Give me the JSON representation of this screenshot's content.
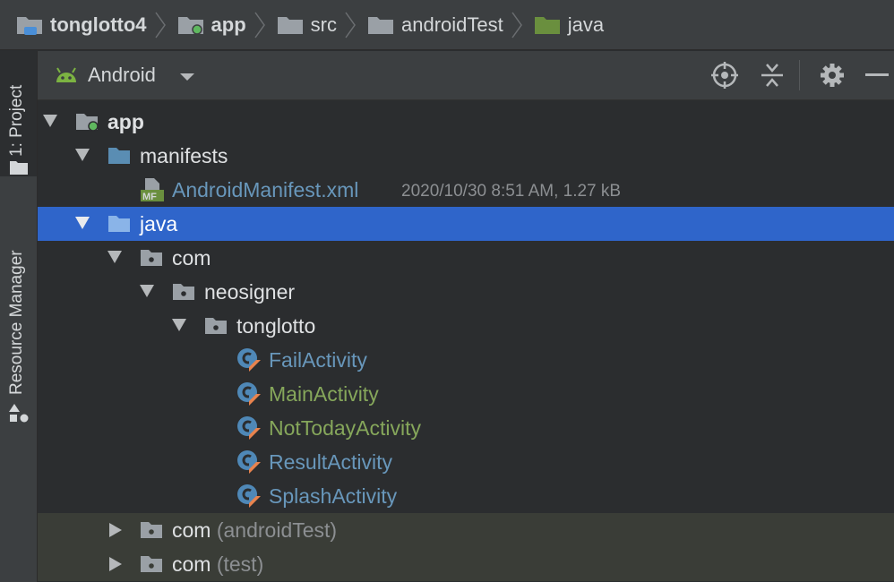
{
  "breadcrumb": [
    {
      "label": "tonglotto4",
      "icon": "project-folder-icon",
      "bold": true
    },
    {
      "label": "app",
      "icon": "module-folder-icon",
      "bold": true
    },
    {
      "label": "src",
      "icon": "folder-icon",
      "bold": false
    },
    {
      "label": "androidTest",
      "icon": "folder-icon",
      "bold": false
    },
    {
      "label": "java",
      "icon": "source-folder-icon",
      "bold": false
    }
  ],
  "stripe": {
    "project_tab": "1: Project",
    "resource_tab": "Resource Manager"
  },
  "toolbar": {
    "view": "Android",
    "icons": [
      "android-icon",
      "dropdown-arrow-icon",
      "locate-icon",
      "collapse-all-icon",
      "settings-gear-icon",
      "hide-minus-icon"
    ]
  },
  "tree": {
    "app": "app",
    "manifests": "manifests",
    "manifest_file": "AndroidManifest.xml",
    "manifest_meta": "2020/10/30 8:51 AM, 1.27 kB",
    "java": "java",
    "com": "com",
    "neosigner": "neosigner",
    "tonglotto": "tonglotto",
    "classes": [
      "FailActivity",
      "MainActivity",
      "NotTodayActivity",
      "ResultActivity",
      "SplashActivity"
    ],
    "com_android_test": "com",
    "android_test_suffix": "(androidTest)",
    "com_test": "com",
    "test_suffix": "(test)"
  },
  "colors": {
    "selection": "#2f65ca",
    "class_blue": "#6897bb",
    "class_green": "#86a75b",
    "generated_row": "#3a3d37"
  }
}
